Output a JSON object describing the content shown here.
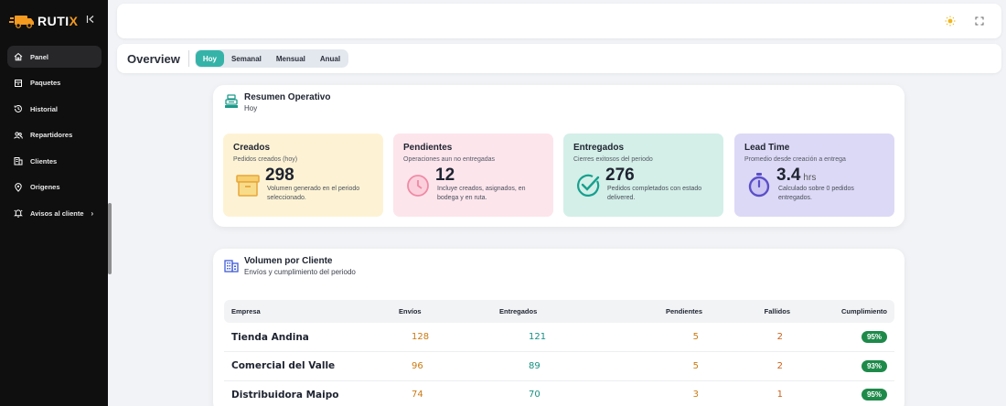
{
  "brand": {
    "name_main": "RUTI",
    "name_accent": "X",
    "collapse_glyph": "|<"
  },
  "sidebar": {
    "items": [
      {
        "label": "Panel",
        "icon": "home-icon"
      },
      {
        "label": "Paquetes",
        "icon": "package-icon"
      },
      {
        "label": "Historial",
        "icon": "history-icon"
      },
      {
        "label": "Repartidores",
        "icon": "users-icon"
      },
      {
        "label": "Clientes",
        "icon": "building-icon"
      },
      {
        "label": "Origenes",
        "icon": "location-icon"
      },
      {
        "label": "Avisos al cliente",
        "icon": "bell-icon"
      }
    ]
  },
  "topbar": {
    "icons": [
      "sun-icon",
      "fullscreen-icon"
    ]
  },
  "overview": {
    "title": "Overview",
    "periods": [
      "Hoy",
      "Semanal",
      "Mensual",
      "Anual"
    ],
    "active_period": "Hoy"
  },
  "resumen": {
    "title": "Resumen Operativo",
    "subtitle": "Hoy",
    "kpis": [
      {
        "title": "Creados",
        "subtitle": "Pedidos creados (hoy)",
        "value": "298",
        "unit": "",
        "desc": "Volumen generado en el periodo seleccionado.",
        "color": "#fdf3d4",
        "icon": "box-icon"
      },
      {
        "title": "Pendientes",
        "subtitle": "Operaciones aun no entregadas",
        "value": "12",
        "unit": "",
        "desc": "Incluye creados, asignados, en bodega y en ruta.",
        "color": "#fde5ec",
        "icon": "clock-icon"
      },
      {
        "title": "Entregados",
        "subtitle": "Cierres exitosos del periodo",
        "value": "276",
        "unit": "",
        "desc": "Pedidos completados con estado delivered.",
        "color": "#d3efe8",
        "icon": "check-circle-icon"
      },
      {
        "title": "Lead Time",
        "subtitle": "Promedio desde creación a entrega",
        "value": "3.4",
        "unit": "hrs",
        "desc": "Calculado sobre 0 pedidos entregados.",
        "color": "#dcd9f6",
        "icon": "stopwatch-icon"
      }
    ]
  },
  "volumen": {
    "title": "Volumen por Cliente",
    "subtitle": "Envíos y cumplimiento del periodo",
    "headers": [
      "Empresa",
      "Envíos",
      "Entregados",
      "Pendientes",
      "Fallidos",
      "Cumplimiento"
    ],
    "rows": [
      {
        "empresa": "Tienda Andina",
        "envios": "128",
        "entregados": "121",
        "pendientes": "5",
        "fallidos": "2",
        "cumplimiento": "95%"
      },
      {
        "empresa": "Comercial del Valle",
        "envios": "96",
        "entregados": "89",
        "pendientes": "5",
        "fallidos": "2",
        "cumplimiento": "93%"
      },
      {
        "empresa": "Distribuidora Maipo",
        "envios": "74",
        "entregados": "70",
        "pendientes": "3",
        "fallidos": "1",
        "cumplimiento": "95%"
      }
    ]
  }
}
